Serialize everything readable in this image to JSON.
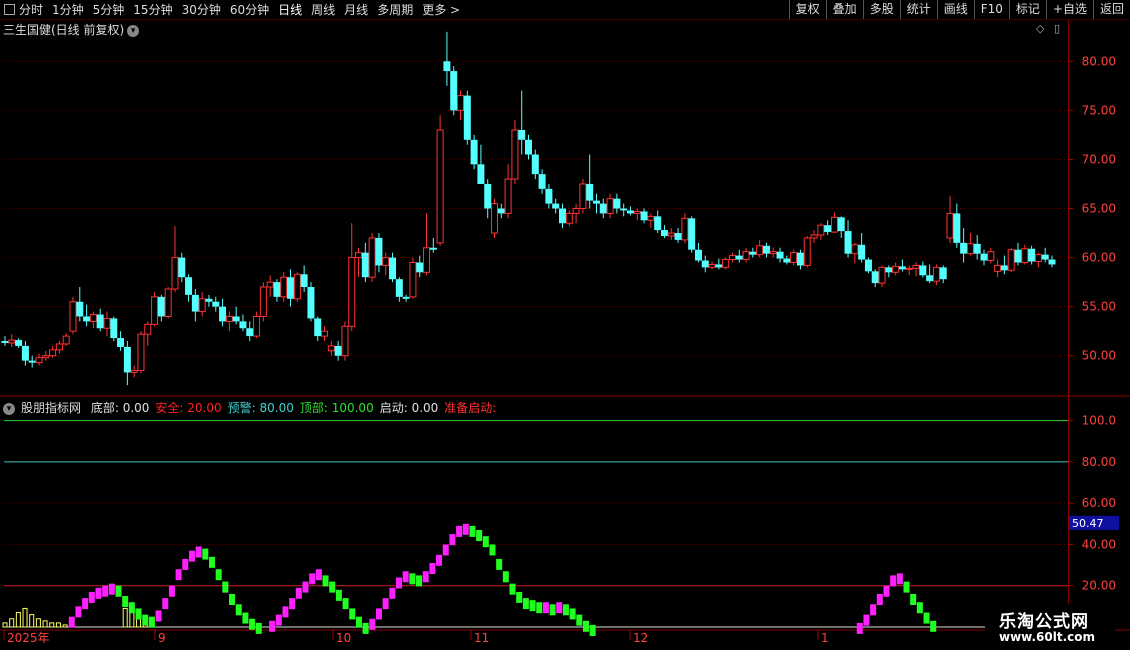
{
  "toolbar": {
    "periods": [
      "分时",
      "1分钟",
      "5分钟",
      "15分钟",
      "30分钟",
      "60分钟",
      "日线",
      "周线",
      "月线",
      "多周期",
      "更多 >"
    ],
    "active_index": 6,
    "buttons": [
      "复权",
      "叠加",
      "多股",
      "统计",
      "画线",
      "F10",
      "标记",
      "+自选",
      "返回"
    ]
  },
  "main_chart": {
    "title": "三生国健(日线 前复权)",
    "price_axis": [
      "80.00",
      "75.00",
      "70.00",
      "65.00",
      "60.00",
      "55.00",
      "50.00"
    ],
    "colors": {
      "up": "#ff3232",
      "down": "#54ffff",
      "grid": "#5a0000"
    }
  },
  "indicator": {
    "name": "股朋指标网",
    "fields": [
      {
        "label": "底部:",
        "value": "0.00",
        "color": "#e0e0e0"
      },
      {
        "label": "安全:",
        "value": "20.00",
        "color": "#ff2020"
      },
      {
        "label": "预警:",
        "value": "80.00",
        "color": "#40d0d0"
      },
      {
        "label": "顶部:",
        "value": "100.00",
        "color": "#30e030"
      },
      {
        "label": "启动:",
        "value": "0.00",
        "color": "#e0e0e0"
      },
      {
        "label": "准备启动:",
        "value": "",
        "color": "#ff3030"
      }
    ],
    "axis": [
      "100.0",
      "80.00",
      "60.00",
      "40.00",
      "20.00"
    ],
    "current_value": "50.47",
    "colors": {
      "magenta": "#ff20ff",
      "green": "#20ff20",
      "yellow": "#ffff60",
      "top": "#30d030",
      "warn": "#40c0c0",
      "safe": "#d02020"
    }
  },
  "time_axis": {
    "labels": [
      "2025年",
      "9",
      "10",
      "11",
      "12",
      "1"
    ]
  },
  "watermark": {
    "line1": "乐淘公式网",
    "line2": "www.60lt.com"
  },
  "chart_data": {
    "type": "candlestick",
    "title": "三生国健(日线 前复权)",
    "ylim": [
      46,
      84
    ],
    "candles_ohlc": [
      [
        51.5,
        52.0,
        51.0,
        51.3
      ],
      [
        51.3,
        52.2,
        50.9,
        51.6
      ],
      [
        51.6,
        51.8,
        50.8,
        51.0
      ],
      [
        51.0,
        51.5,
        49.0,
        49.5
      ],
      [
        49.5,
        50.0,
        48.8,
        49.3
      ],
      [
        49.3,
        50.2,
        49.0,
        49.8
      ],
      [
        49.8,
        50.5,
        49.5,
        50.0
      ],
      [
        50.0,
        51.0,
        49.8,
        50.6
      ],
      [
        50.6,
        51.5,
        50.2,
        51.2
      ],
      [
        51.2,
        52.3,
        51.0,
        52.0
      ],
      [
        52.5,
        56.0,
        52.2,
        55.5
      ],
      [
        55.5,
        57.0,
        53.5,
        54.0
      ],
      [
        54.0,
        55.2,
        53.0,
        53.5
      ],
      [
        53.5,
        54.5,
        52.8,
        54.2
      ],
      [
        54.2,
        54.8,
        52.5,
        52.8
      ],
      [
        52.8,
        54.5,
        52.0,
        53.8
      ],
      [
        53.8,
        54.0,
        51.5,
        51.8
      ],
      [
        51.8,
        52.5,
        50.5,
        50.9
      ],
      [
        50.9,
        51.5,
        47.0,
        48.3
      ],
      [
        48.3,
        49.0,
        47.8,
        48.5
      ],
      [
        48.5,
        52.5,
        48.2,
        52.2
      ],
      [
        52.2,
        53.5,
        51.0,
        53.2
      ],
      [
        53.2,
        56.5,
        53.0,
        56.0
      ],
      [
        56.0,
        56.2,
        53.5,
        54.0
      ],
      [
        54.0,
        57.0,
        53.8,
        56.8
      ],
      [
        56.8,
        63.2,
        56.5,
        60.0
      ],
      [
        60.0,
        60.5,
        57.5,
        58.0
      ],
      [
        58.0,
        58.3,
        55.5,
        56.2
      ],
      [
        56.2,
        56.8,
        53.5,
        54.5
      ],
      [
        54.5,
        56.5,
        54.0,
        55.8
      ],
      [
        55.8,
        56.2,
        55.0,
        55.5
      ],
      [
        55.5,
        56.0,
        54.5,
        55.0
      ],
      [
        55.0,
        55.8,
        53.0,
        53.5
      ],
      [
        53.5,
        54.5,
        52.5,
        54.0
      ],
      [
        54.0,
        55.0,
        53.2,
        53.5
      ],
      [
        53.5,
        54.2,
        52.5,
        52.8
      ],
      [
        52.8,
        53.5,
        51.5,
        52.0
      ],
      [
        52.0,
        54.5,
        51.8,
        54.0
      ],
      [
        54.0,
        57.5,
        53.5,
        57.0
      ],
      [
        57.0,
        58.2,
        56.0,
        57.5
      ],
      [
        57.5,
        57.8,
        55.5,
        56.0
      ],
      [
        56.0,
        58.5,
        55.5,
        58.0
      ],
      [
        58.0,
        58.8,
        55.0,
        55.8
      ],
      [
        55.8,
        58.5,
        55.5,
        58.3
      ],
      [
        58.3,
        59.2,
        56.5,
        57.0
      ],
      [
        57.0,
        57.5,
        53.5,
        53.8
      ],
      [
        53.8,
        54.0,
        51.5,
        52.0
      ],
      [
        52.0,
        53.0,
        51.5,
        52.5
      ],
      [
        50.5,
        51.5,
        50.0,
        51.0
      ],
      [
        51.0,
        51.5,
        49.5,
        50.0
      ],
      [
        50.0,
        53.5,
        49.5,
        53.0
      ],
      [
        53.0,
        63.5,
        52.5,
        60.0
      ],
      [
        60.0,
        61.0,
        58.0,
        60.5
      ],
      [
        60.5,
        61.5,
        57.5,
        58.0
      ],
      [
        58.0,
        62.5,
        57.5,
        62.0
      ],
      [
        62.0,
        62.5,
        58.5,
        59.2
      ],
      [
        59.2,
        60.5,
        58.2,
        60.0
      ],
      [
        60.0,
        60.5,
        57.5,
        57.8
      ],
      [
        57.8,
        58.0,
        55.5,
        56.0
      ],
      [
        56.0,
        56.2,
        55.5,
        55.8
      ],
      [
        56.0,
        60.0,
        55.8,
        59.5
      ],
      [
        59.5,
        60.2,
        58.0,
        58.5
      ],
      [
        58.5,
        64.5,
        58.2,
        61.0
      ],
      [
        61.0,
        62.0,
        60.5,
        60.8
      ],
      [
        61.5,
        74.5,
        61.2,
        73.0
      ],
      [
        80.0,
        83.0,
        77.5,
        79.0
      ],
      [
        79.0,
        79.5,
        74.5,
        75.0
      ],
      [
        75.0,
        77.0,
        74.0,
        76.5
      ],
      [
        76.5,
        77.0,
        71.5,
        72.0
      ],
      [
        72.0,
        72.5,
        69.0,
        69.5
      ],
      [
        69.5,
        71.5,
        67.5,
        67.5
      ],
      [
        67.5,
        68.0,
        64.0,
        65.0
      ],
      [
        62.5,
        66.0,
        62.0,
        65.5
      ],
      [
        65.0,
        65.5,
        64.0,
        64.5
      ],
      [
        64.5,
        69.5,
        64.0,
        68.0
      ],
      [
        68.0,
        74.0,
        67.5,
        73.0
      ],
      [
        73.0,
        77.0,
        70.5,
        72.0
      ],
      [
        72.0,
        72.5,
        70.0,
        70.5
      ],
      [
        70.5,
        71.0,
        68.0,
        68.5
      ],
      [
        68.5,
        69.0,
        66.5,
        67.0
      ],
      [
        67.0,
        67.5,
        65.0,
        65.5
      ],
      [
        65.5,
        66.0,
        64.5,
        65.0
      ],
      [
        65.0,
        65.5,
        63.0,
        63.5
      ],
      [
        63.5,
        64.8,
        63.2,
        64.5
      ],
      [
        64.5,
        65.5,
        63.5,
        65.0
      ],
      [
        65.0,
        68.0,
        64.5,
        67.5
      ],
      [
        67.5,
        70.5,
        65.0,
        65.8
      ],
      [
        65.8,
        66.5,
        64.5,
        65.5
      ],
      [
        65.5,
        66.0,
        64.0,
        64.5
      ],
      [
        64.5,
        66.5,
        64.0,
        66.0
      ],
      [
        66.0,
        66.5,
        64.5,
        65.0
      ],
      [
        65.0,
        65.5,
        64.2,
        64.8
      ],
      [
        64.8,
        65.2,
        64.3,
        64.5
      ],
      [
        64.5,
        65.0,
        63.8,
        64.7
      ],
      [
        64.7,
        65.0,
        63.5,
        63.8
      ],
      [
        63.8,
        64.5,
        63.0,
        64.2
      ],
      [
        64.2,
        64.8,
        62.5,
        62.8
      ],
      [
        62.8,
        63.3,
        62.0,
        62.2
      ],
      [
        62.2,
        63.0,
        61.8,
        62.5
      ],
      [
        62.5,
        63.0,
        61.5,
        61.8
      ],
      [
        61.8,
        64.5,
        61.5,
        64.0
      ],
      [
        64.0,
        64.2,
        60.5,
        60.8
      ],
      [
        60.8,
        61.5,
        59.5,
        59.7
      ],
      [
        59.7,
        60.2,
        58.5,
        59.0
      ],
      [
        59.0,
        59.6,
        58.8,
        59.3
      ],
      [
        59.3,
        59.9,
        58.8,
        59.0
      ],
      [
        59.0,
        60.0,
        58.8,
        59.8
      ],
      [
        59.8,
        60.5,
        59.5,
        60.2
      ],
      [
        60.2,
        60.8,
        59.5,
        59.8
      ],
      [
        59.8,
        61.0,
        59.5,
        60.6
      ],
      [
        60.6,
        61.0,
        60.0,
        60.3
      ],
      [
        60.3,
        61.8,
        60.0,
        61.2
      ],
      [
        61.2,
        61.5,
        60.0,
        60.4
      ],
      [
        60.4,
        61.0,
        60.0,
        60.6
      ],
      [
        60.6,
        61.0,
        59.5,
        59.9
      ],
      [
        59.9,
        60.2,
        59.3,
        59.5
      ],
      [
        59.5,
        60.8,
        59.2,
        60.5
      ],
      [
        60.5,
        60.8,
        58.8,
        59.2
      ],
      [
        59.2,
        62.2,
        59.0,
        62.0
      ],
      [
        62.0,
        62.8,
        61.5,
        62.3
      ],
      [
        62.3,
        63.5,
        61.8,
        63.3
      ],
      [
        63.3,
        63.8,
        62.3,
        62.6
      ],
      [
        62.6,
        64.6,
        62.5,
        64.1
      ],
      [
        64.1,
        64.2,
        62.0,
        62.7
      ],
      [
        62.7,
        63.8,
        60.0,
        60.4
      ],
      [
        60.4,
        61.5,
        59.4,
        61.3
      ],
      [
        61.3,
        62.5,
        59.5,
        59.8
      ],
      [
        59.8,
        60.0,
        58.4,
        58.6
      ],
      [
        58.6,
        58.8,
        57.0,
        57.4
      ],
      [
        57.4,
        59.2,
        57.0,
        59.0
      ],
      [
        59.0,
        59.2,
        58.0,
        58.5
      ],
      [
        58.5,
        59.5,
        58.2,
        59.1
      ],
      [
        59.1,
        59.8,
        58.6,
        58.8
      ],
      [
        58.8,
        59.2,
        58.2,
        58.9
      ],
      [
        58.9,
        59.5,
        58.1,
        59.2
      ],
      [
        59.2,
        59.6,
        58.0,
        58.2
      ],
      [
        58.2,
        59.3,
        57.4,
        57.6
      ],
      [
        57.6,
        59.3,
        57.2,
        59.0
      ],
      [
        59.0,
        59.2,
        57.4,
        57.8
      ],
      [
        62.0,
        66.3,
        61.5,
        64.5
      ],
      [
        64.5,
        65.5,
        61.0,
        61.5
      ],
      [
        61.5,
        63.0,
        59.5,
        60.4
      ],
      [
        60.4,
        62.5,
        60.2,
        61.4
      ],
      [
        61.4,
        62.3,
        59.8,
        60.4
      ],
      [
        60.4,
        60.8,
        59.2,
        59.7
      ],
      [
        59.7,
        61.0,
        59.4,
        60.6
      ],
      [
        58.6,
        59.8,
        58.0,
        59.2
      ],
      [
        59.2,
        60.2,
        58.3,
        58.7
      ],
      [
        58.7,
        61.0,
        58.5,
        60.8
      ],
      [
        60.8,
        61.5,
        59.2,
        59.5
      ],
      [
        59.5,
        61.3,
        59.3,
        60.9
      ],
      [
        60.9,
        61.2,
        59.3,
        59.6
      ],
      [
        59.6,
        60.5,
        59.0,
        60.3
      ],
      [
        60.3,
        61.0,
        59.5,
        59.8
      ],
      [
        59.8,
        60.2,
        59.0,
        59.3
      ]
    ],
    "indicator_values": [
      0,
      0,
      0,
      0,
      0,
      0,
      0,
      0,
      0,
      0,
      5,
      10,
      14,
      17,
      19,
      20,
      21,
      20,
      15,
      12,
      9,
      6,
      5,
      8,
      14,
      20,
      28,
      33,
      37,
      39,
      38,
      34,
      28,
      22,
      16,
      11,
      7,
      4,
      2,
      0,
      3,
      6,
      10,
      14,
      19,
      22,
      26,
      28,
      25,
      22,
      18,
      14,
      9,
      5,
      2,
      4,
      9,
      14,
      19,
      24,
      27,
      26,
      25,
      27,
      31,
      35,
      40,
      45,
      49,
      50,
      49,
      47,
      44,
      40,
      33,
      27,
      21,
      17,
      14,
      13,
      12,
      12,
      11,
      12,
      11,
      9,
      6,
      3,
      1,
      0,
      0,
      0,
      0,
      0,
      0,
      0,
      0,
      0,
      0,
      0,
      0,
      0,
      0,
      0,
      0,
      0,
      0,
      0,
      0,
      0,
      0,
      0,
      0,
      0,
      0,
      0,
      0,
      0,
      0,
      0,
      0,
      0,
      0,
      0,
      0,
      0,
      0,
      0,
      2,
      6,
      11,
      16,
      20,
      25,
      26,
      22,
      16,
      12,
      7,
      3,
      0,
      0,
      0,
      0,
      0,
      0,
      0,
      0,
      0,
      0
    ],
    "yellow_bars": [
      2,
      4,
      7,
      9,
      6,
      4,
      3,
      2,
      2,
      1,
      0,
      0,
      0,
      0,
      0,
      0,
      0,
      0,
      9,
      7,
      4,
      2,
      0,
      0,
      0,
      0,
      0,
      0,
      0,
      0,
      0,
      0,
      0,
      0,
      0,
      0,
      0,
      0,
      0,
      0,
      0,
      0,
      0,
      0,
      0,
      0,
      0,
      0,
      0,
      0,
      0,
      0,
      0,
      0,
      0,
      0,
      0,
      0,
      0,
      0,
      0,
      0,
      0,
      0,
      0,
      0,
      0,
      0,
      0,
      0,
      0,
      0,
      0,
      0,
      0,
      0,
      0,
      0,
      0,
      0,
      0,
      0,
      0,
      0,
      0,
      0,
      0,
      0,
      0,
      0,
      0,
      0,
      0,
      0,
      0,
      0,
      0,
      0,
      0,
      0,
      0,
      0,
      0,
      0,
      0,
      0,
      0,
      0,
      0,
      0,
      0,
      0,
      0,
      0,
      0,
      0,
      0,
      0,
      0,
      0,
      0,
      0,
      0,
      0,
      0,
      0,
      0,
      0,
      0,
      0,
      0,
      0,
      0,
      0,
      0,
      0,
      0,
      0,
      0,
      0,
      0,
      0,
      0,
      0,
      0,
      0,
      0,
      0,
      0,
      0
    ]
  }
}
